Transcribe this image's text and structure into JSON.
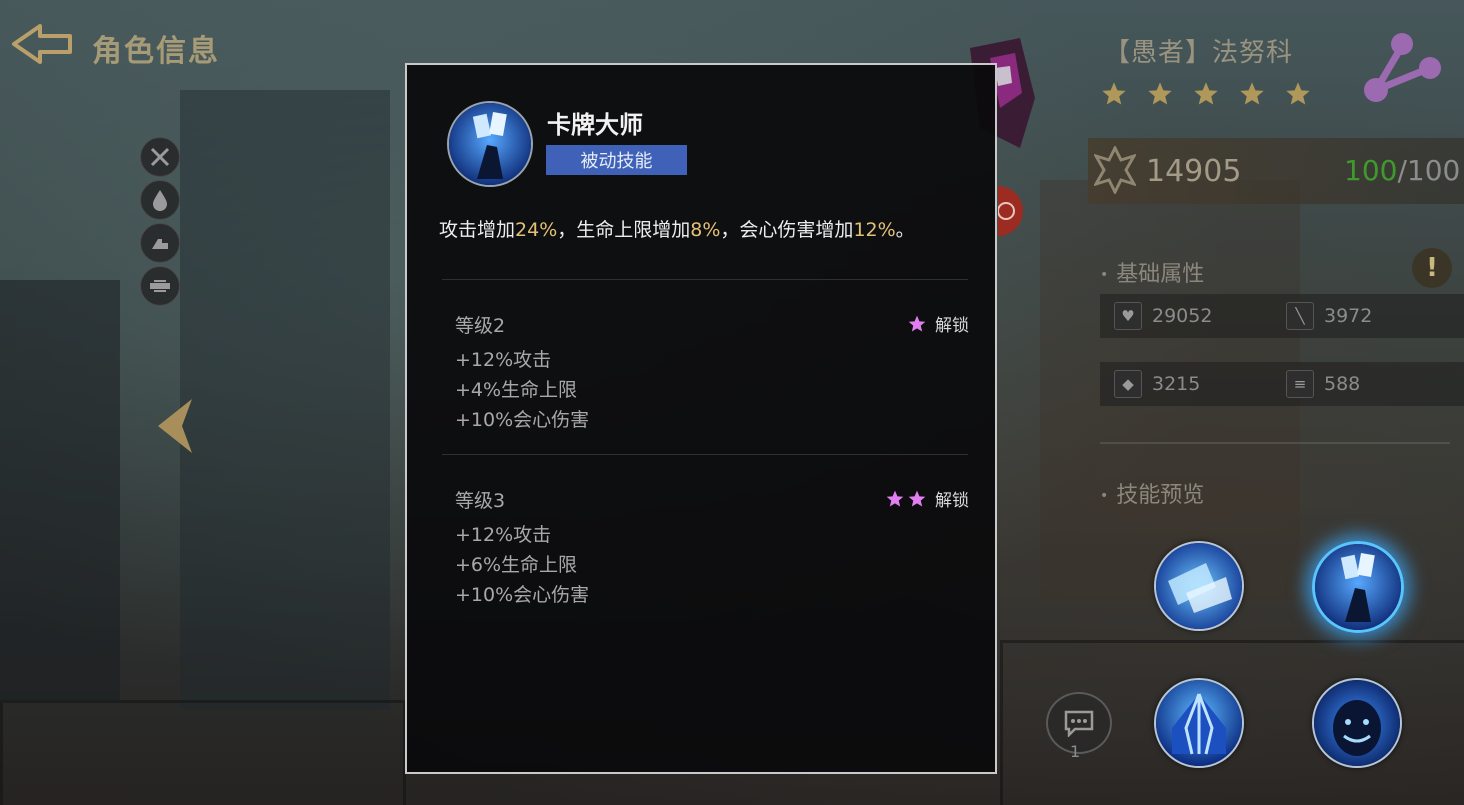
{
  "header": {
    "title": "角色信息",
    "left_icons": [
      "crossed-swords-icon",
      "water-drop-icon",
      "flex-arm-icon",
      "weapon-icon"
    ]
  },
  "hero": {
    "name": "【愚者】法努科",
    "stars": 5,
    "power": "14905",
    "energy_current": "100",
    "energy_sep_max": "/100"
  },
  "attributes": {
    "label": "基础属性",
    "stats": [
      {
        "icon": "heart-icon",
        "value": "29052"
      },
      {
        "icon": "sword-icon",
        "value": "3972"
      },
      {
        "icon": "shield-icon",
        "value": "3215"
      },
      {
        "icon": "speed-icon",
        "value": "588"
      }
    ]
  },
  "skills_preview": {
    "label": "技能预览",
    "chat_count": "1"
  },
  "popup": {
    "skill_name": "卡牌大师",
    "skill_type": "被动技能",
    "description": {
      "p1": "攻击增加",
      "n1": "24%",
      "p2": "，生命上限增加",
      "n2": "8%",
      "p3": "，会心伤害增加",
      "n3": "12%",
      "p4": "。"
    },
    "levels": [
      {
        "title": "等级2",
        "unlock_stars": 1,
        "unlock_label": "解锁",
        "bonuses": [
          "+12%攻击",
          "+4%生命上限",
          "+10%会心伤害"
        ]
      },
      {
        "title": "等级3",
        "unlock_stars": 2,
        "unlock_label": "解锁",
        "bonuses": [
          "+12%攻击",
          "+6%生命上限",
          "+10%会心伤害"
        ]
      }
    ]
  },
  "colors": {
    "accent_gold": "#e3c176",
    "tag_blue": "#3f62b8",
    "star_pink": "#e27ff0",
    "energy_green": "#3f9a2d"
  }
}
